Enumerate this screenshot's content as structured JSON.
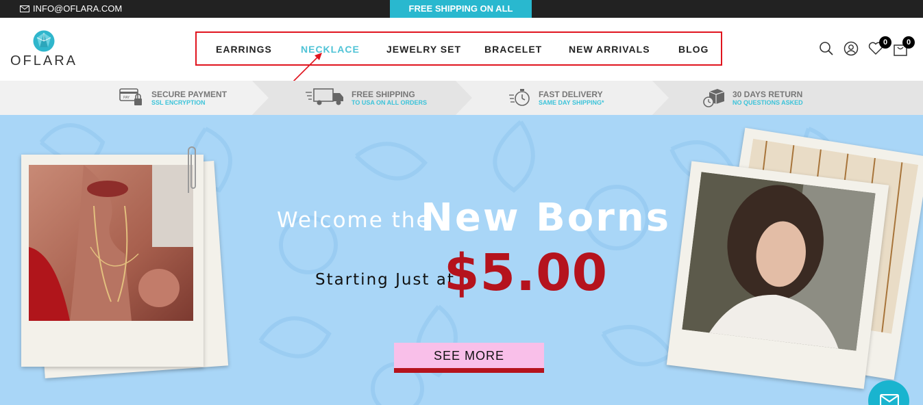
{
  "topbar": {
    "email": "INFO@OFLARA.COM",
    "shipping_banner": "FREE SHIPPING ON ALL ORDERS"
  },
  "header": {
    "logo_text": "OFLARA",
    "nav": [
      {
        "label": "EARRINGS",
        "active": false
      },
      {
        "label": "NECKLACE",
        "active": true
      },
      {
        "label": "JEWELRY SET",
        "active": false
      },
      {
        "label": "BRACELET",
        "active": false
      },
      {
        "label": "NEW ARRIVALS",
        "active": false
      },
      {
        "label": "BLOG",
        "active": false
      }
    ],
    "wishlist_count": "0",
    "cart_count": "0",
    "icons": [
      "search-icon",
      "account-icon",
      "wishlist-heart-icon",
      "cart-bag-icon"
    ]
  },
  "benefits": [
    {
      "title": "SECURE PAYMENT",
      "subtitle": "SSL ENCRYPTION",
      "icon": "secure-card-icon"
    },
    {
      "title": "FREE SHIPPING",
      "subtitle": "TO USA ON ALL ORDERS",
      "icon": "truck-icon"
    },
    {
      "title": "FAST DELIVERY",
      "subtitle": "SAME DAY SHIPPING*",
      "icon": "stopwatch-icon"
    },
    {
      "title": "30 DAYS RETURN",
      "subtitle": "NO QUESTIONS ASKED",
      "icon": "return-box-icon"
    }
  ],
  "hero": {
    "welcome": "Welcome the",
    "headline": "New Borns",
    "starting": "Starting Just at",
    "price": "$5.00",
    "cta": "SEE MORE"
  },
  "colors": {
    "accent": "#29b8cf",
    "nav_active": "#4fc3d6",
    "price_red": "#b5131d",
    "hero_bg": "#a9d6f7",
    "cta_bg": "#f9bfe9",
    "annotation_red": "#e0141e"
  }
}
